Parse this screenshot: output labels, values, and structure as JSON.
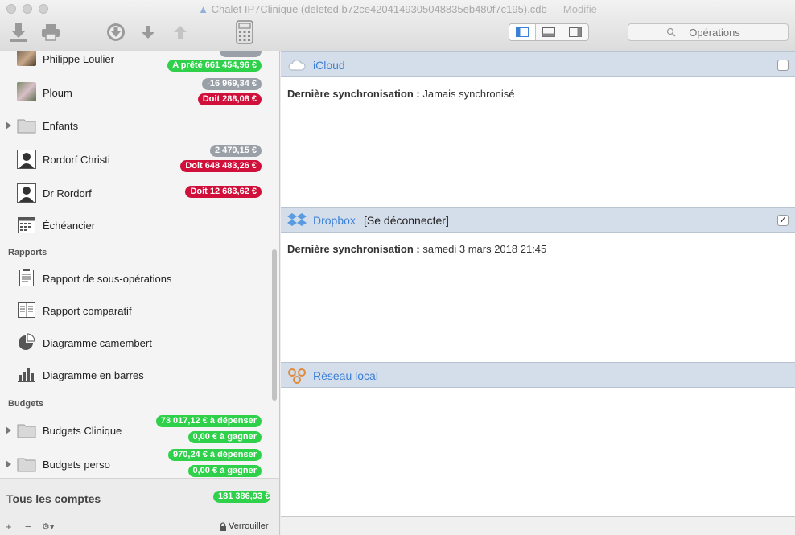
{
  "window": {
    "title": "Chalet IP7Clinique (deleted b72ce4204149305048835eb480f7c195).cdb",
    "modified": " — Modifié"
  },
  "search": {
    "placeholder": "Opérations"
  },
  "sidebar": {
    "accounts": [
      {
        "name": "Philippe Loulier",
        "badges": [
          {
            "text": "A prêté 661 454,96 €",
            "color": "green"
          }
        ]
      },
      {
        "name": "Ploum",
        "badges": [
          {
            "text": "-16 969,34 €",
            "color": "gray"
          },
          {
            "text": "Doit 288,08 €",
            "color": "red"
          }
        ]
      },
      {
        "name": "Enfants",
        "badges": []
      },
      {
        "name": "Rordorf Christi",
        "badges": [
          {
            "text": "2 479,15 €",
            "color": "gray"
          },
          {
            "text": "Doit 648 483,26 €",
            "color": "red"
          }
        ]
      },
      {
        "name": "Dr Rordorf",
        "badges": [
          {
            "text": "Doit 12 683,62 €",
            "color": "red"
          }
        ]
      },
      {
        "name": "Échéancier",
        "badges": []
      }
    ],
    "reports_header": "Rapports",
    "reports": [
      {
        "name": "Rapport de sous-opérations",
        "icon": "report-list-icon"
      },
      {
        "name": "Rapport comparatif",
        "icon": "report-compare-icon"
      },
      {
        "name": "Diagramme camembert",
        "icon": "pie-chart-icon"
      },
      {
        "name": "Diagramme en barres",
        "icon": "bar-chart-icon"
      }
    ],
    "budgets_header": "Budgets",
    "budgets": [
      {
        "name": "Budgets Clinique",
        "badges": [
          {
            "text": "73 017,12 € à dépenser",
            "color": "green"
          },
          {
            "text": "0,00 € à gagner",
            "color": "green"
          }
        ]
      },
      {
        "name": "Budgets perso",
        "badges": [
          {
            "text": "970,24 € à dépenser",
            "color": "green"
          },
          {
            "text": "0,00 € à gagner",
            "color": "green"
          }
        ]
      }
    ],
    "total_label": "Tous les comptes",
    "total_value": "181 386,93 €",
    "footer": {
      "add": "+",
      "remove": "−",
      "gear": "⚙▾",
      "lock": "Verrouiller"
    }
  },
  "sync": [
    {
      "name": "iCloud",
      "extra": "",
      "checked": false,
      "label": "Dernière synchronisation :",
      "value": "Jamais synchronisé"
    },
    {
      "name": "Dropbox",
      "extra": "[Se déconnecter]",
      "checked": true,
      "label": "Dernière synchronisation :",
      "value": "samedi 3 mars 2018 21:45"
    },
    {
      "name": "Réseau local",
      "extra": "",
      "checked": false,
      "label": "",
      "value": ""
    }
  ],
  "colors": {
    "green": "#2fd14b",
    "red": "#d0103a",
    "gray": "#9aa0a8",
    "link": "#3b7fd6"
  }
}
